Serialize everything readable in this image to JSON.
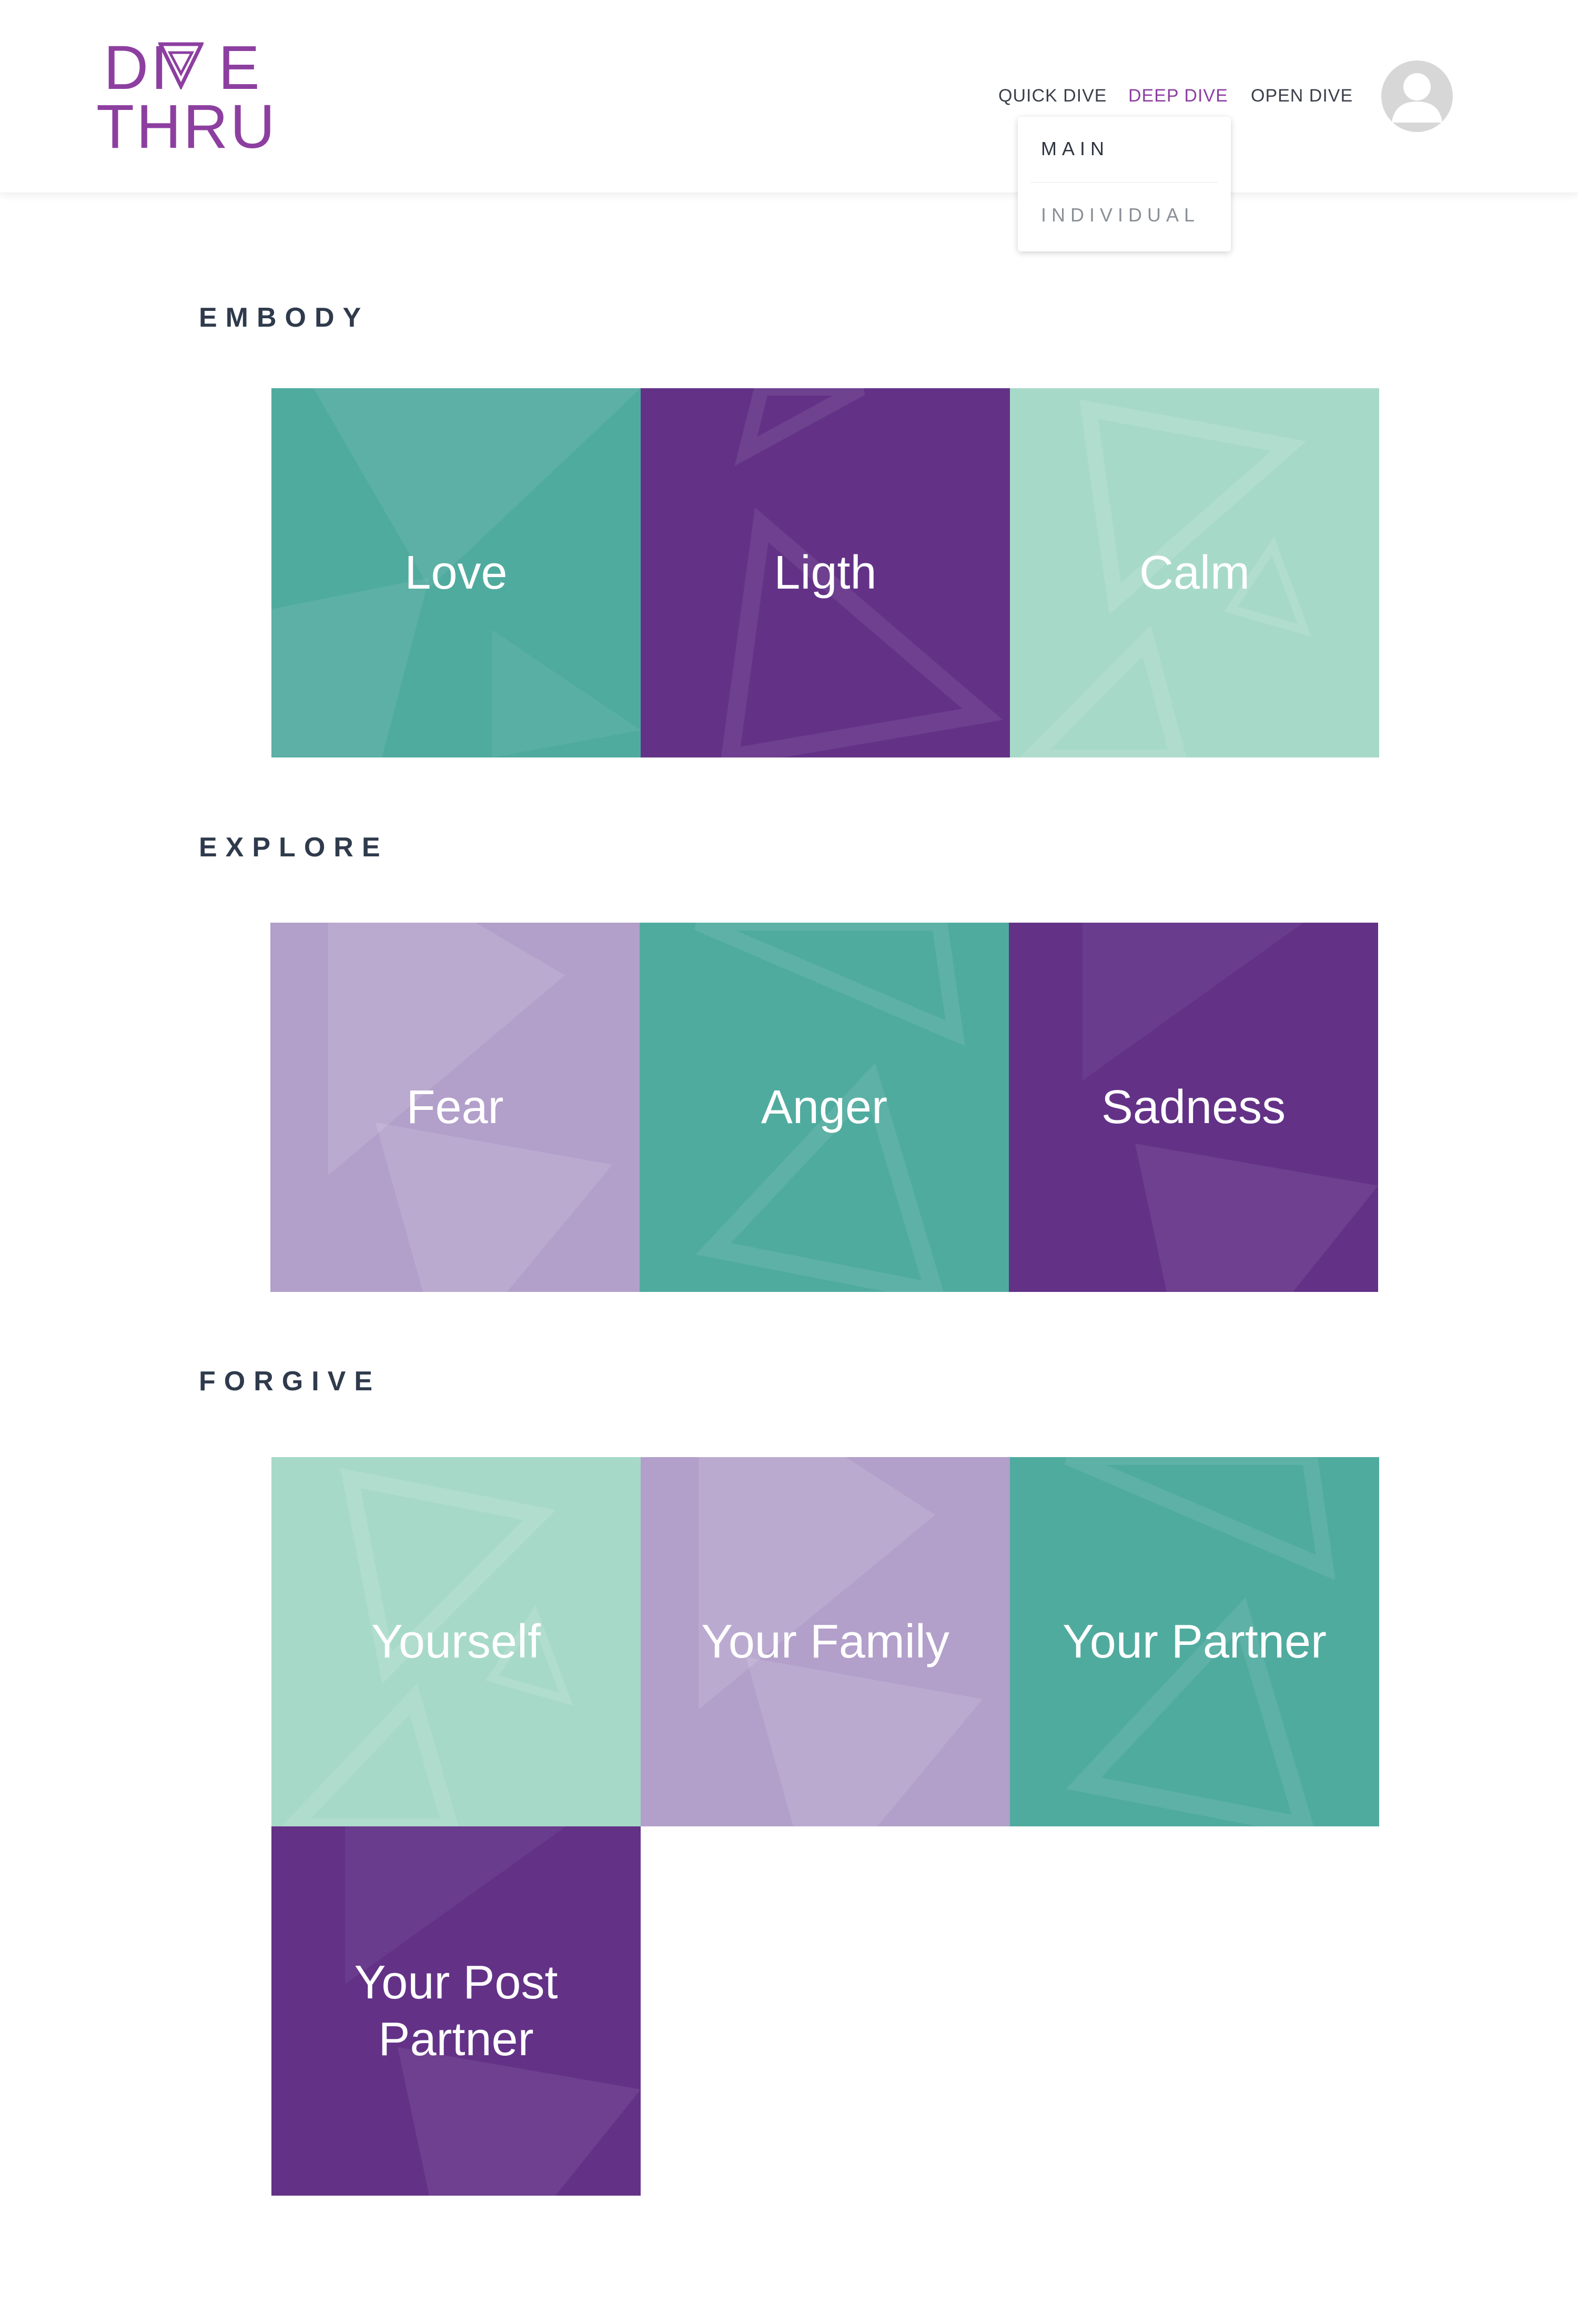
{
  "logo": {
    "line1": "DIVE",
    "line1_left": "DI",
    "line1_right": "E",
    "line2": "THRU"
  },
  "nav": {
    "quick": "QUICK DIVE",
    "deep": "DEEP DIVE",
    "open": "OPEN DIVE"
  },
  "dropdown": {
    "main": "MAIN",
    "individual": "INDIVIDUAL"
  },
  "colors": {
    "teal": "#50ab9f",
    "lavender": "#b29fca",
    "purple": "#633287",
    "mint": "#a7d9c9",
    "brand": "#8d3fa0"
  },
  "sections": {
    "embody": {
      "title": "EMBODY",
      "tiles": [
        {
          "label": "Love",
          "color": "teal"
        },
        {
          "label": "Ligth",
          "color": "purple"
        },
        {
          "label": "Calm",
          "color": "mint"
        }
      ]
    },
    "explore": {
      "title": "EXPLORE",
      "tiles": [
        {
          "label": "Fear",
          "color": "lavender"
        },
        {
          "label": "Anger",
          "color": "teal"
        },
        {
          "label": "Sadness",
          "color": "purple"
        }
      ]
    },
    "forgive": {
      "title": "FORGIVE",
      "tiles": [
        {
          "label": "Yourself",
          "color": "mint"
        },
        {
          "label": "Your Family",
          "color": "lavender"
        },
        {
          "label": "Your Partner",
          "color": "teal"
        },
        {
          "label": "Your Post\nPartner",
          "color": "purple"
        }
      ]
    }
  }
}
